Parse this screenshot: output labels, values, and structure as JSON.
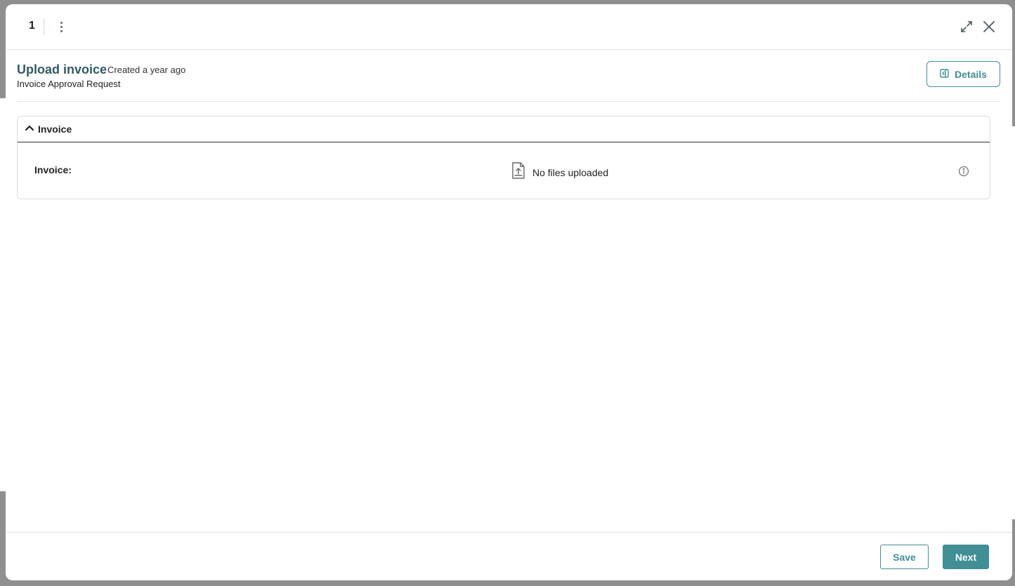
{
  "topbar": {
    "step_number": "1",
    "icons": {
      "menu": "kebab-menu-icon",
      "expand": "expand-icon",
      "close": "close-icon"
    }
  },
  "header": {
    "title": "Upload invoice",
    "created": "Created a year ago",
    "subtitle": "Invoice Approval Request",
    "details_label": "Details"
  },
  "panel": {
    "title": "Invoice",
    "field_label": "Invoice:",
    "file_status": "No files uploaded"
  },
  "footer": {
    "save_label": "Save",
    "next_label": "Next"
  },
  "colors": {
    "accent": "#3f8f95",
    "title": "#2f5c64",
    "overlay": "#8f8f8f"
  }
}
